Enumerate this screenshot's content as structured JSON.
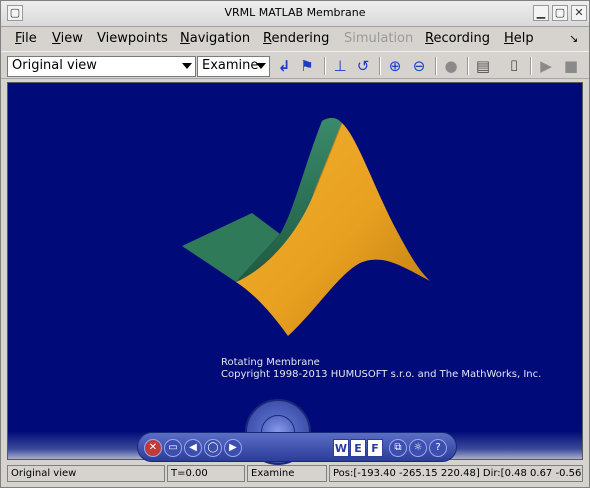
{
  "window": {
    "title": "VRML MATLAB Membrane"
  },
  "menu": [
    {
      "label": "File",
      "underline": "F",
      "rest": "ile",
      "enabled": true
    },
    {
      "label": "View",
      "underline": "V",
      "rest": "iew",
      "enabled": true
    },
    {
      "label": "Viewpoints",
      "underline": "",
      "rest": "Viewpoints",
      "enabled": true
    },
    {
      "label": "Navigation",
      "underline": "N",
      "rest": "avigation",
      "enabled": true
    },
    {
      "label": "Rendering",
      "underline": "R",
      "rest": "endering",
      "enabled": true
    },
    {
      "label": "Simulation",
      "underline": "",
      "rest": "Simulation",
      "enabled": false
    },
    {
      "label": "Recording",
      "underline": "R",
      "rest": "ecording",
      "enabled": true
    },
    {
      "label": "Help",
      "underline": "H",
      "rest": "elp",
      "enabled": true
    }
  ],
  "toolbar": {
    "viewpoint_select": "Original view",
    "navigation_mode_select": "Examine",
    "icons": [
      "return-icon",
      "flag-icon",
      "straighten-up-icon",
      "undo-move-icon",
      "zoom-in-icon",
      "zoom-out-icon",
      "record-icon",
      "capture-list-icon",
      "camera-icon",
      "play-icon",
      "stop-icon"
    ]
  },
  "canvas": {
    "background": "#000a78",
    "caption_line1": "Rotating Membrane",
    "caption_line2": "Copyright 1998-2013 HUMUSOFT s.r.o. and The MathWorks, Inc.",
    "membrane_colors": {
      "front": "#e8a020",
      "side": "#2e7a5a"
    }
  },
  "nav_panel": {
    "letters": [
      "W",
      "E",
      "F"
    ]
  },
  "status": {
    "viewpoint": "Original view",
    "time": "T=0.00",
    "mode": "Examine",
    "position": "Pos:[-193.40 -265.15 220.48] Dir:[0.48 0.67 -0.56]"
  }
}
